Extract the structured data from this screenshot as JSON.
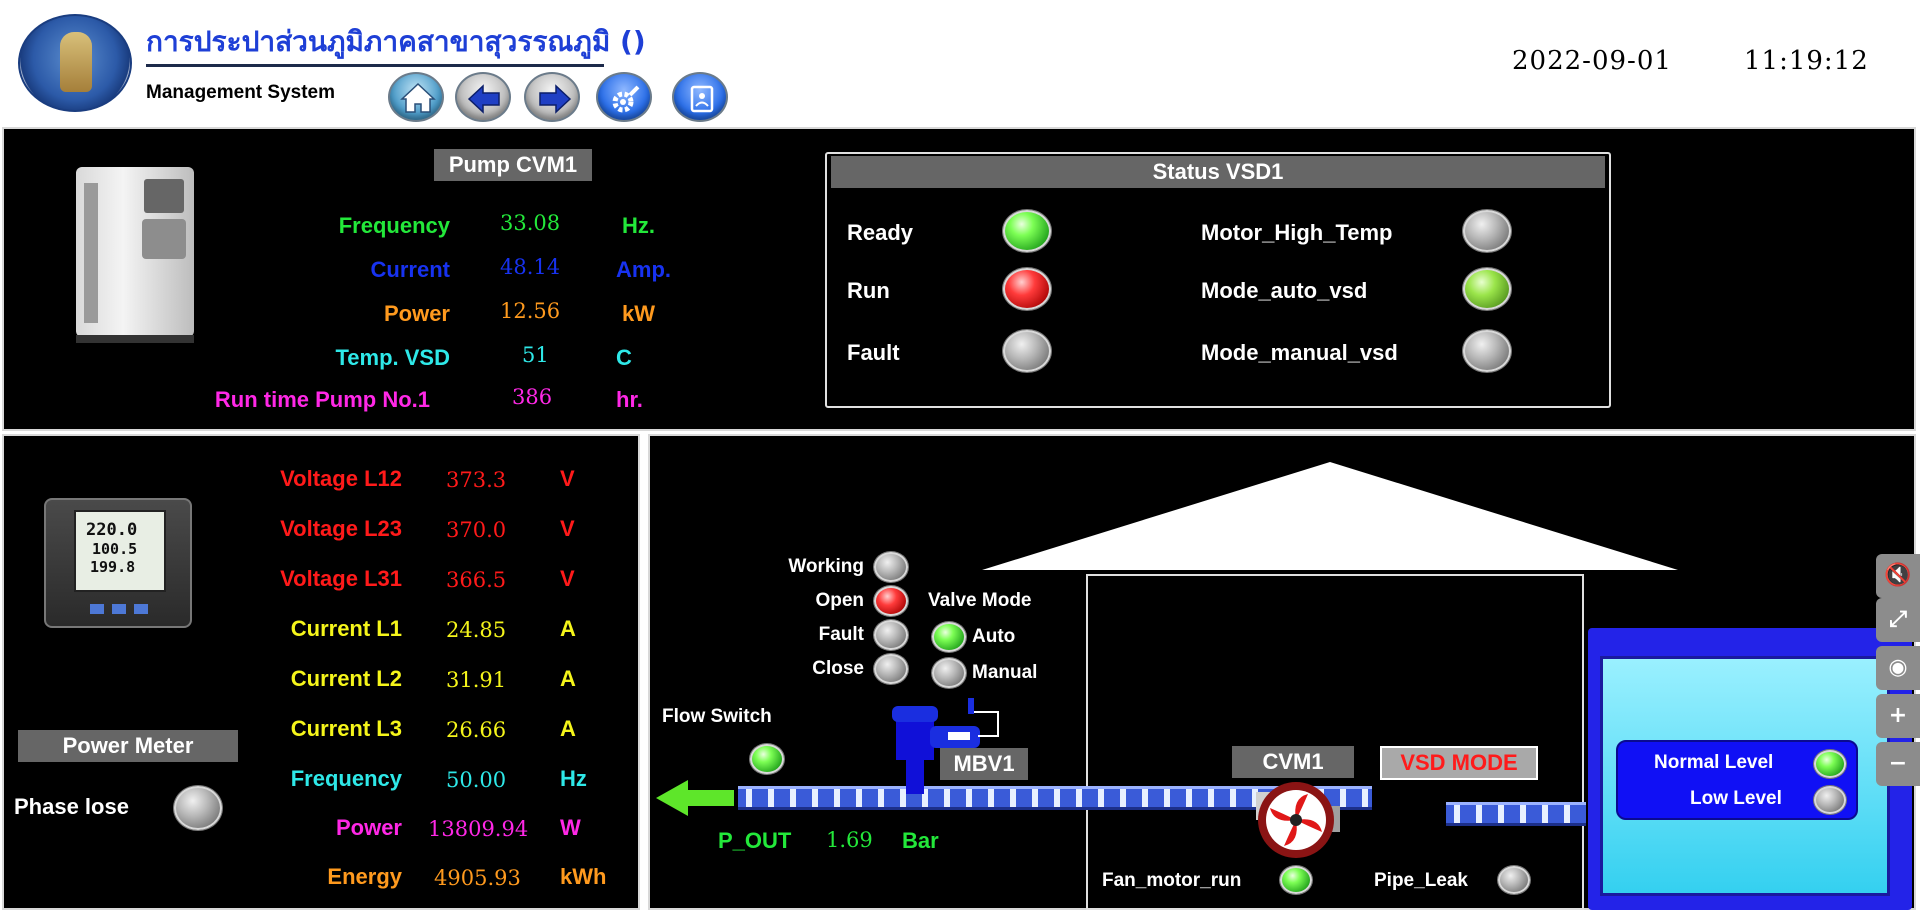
{
  "header": {
    "title": "การประปาส่วนภูมิภาคสาขาสุวรรณภูมิ ()",
    "subtitle": "Management System",
    "date": "2022-09-01",
    "time": "11:19:12",
    "nav": [
      "home-icon",
      "back-arrow-icon",
      "forward-arrow-icon",
      "settings-icon",
      "report-icon"
    ]
  },
  "pump": {
    "title": "Pump CVM1",
    "rows": [
      {
        "label": "Frequency",
        "value": "33.08",
        "unit": "Hz.",
        "color": "#23e83a"
      },
      {
        "label": "Current",
        "value": "48.14",
        "unit": "Amp.",
        "color": "#1732f0"
      },
      {
        "label": "Power",
        "value": "12.56",
        "unit": "kW",
        "color": "#ff9a1e"
      },
      {
        "label": "Temp. VSD",
        "value": "51",
        "unit": "C",
        "color": "#2ee8e8"
      },
      {
        "label": "Run time Pump No.1",
        "value": "386",
        "unit": "hr.",
        "color": "#ff28e6"
      }
    ]
  },
  "status": {
    "title": "Status VSD1",
    "left": [
      {
        "label": "Ready",
        "state": "green"
      },
      {
        "label": "Run",
        "state": "red"
      },
      {
        "label": "Fault",
        "state": "gray"
      }
    ],
    "right": [
      {
        "label": "Motor_High_Temp",
        "state": "gray"
      },
      {
        "label": "Mode_auto_vsd",
        "state": "lime"
      },
      {
        "label": "Mode_manual_vsd",
        "state": "gray"
      }
    ]
  },
  "meter": {
    "title": "Power Meter",
    "phase_lose": "Phase lose",
    "display": [
      "220.0",
      "100.5",
      "199.8"
    ],
    "rows": [
      {
        "label": "Voltage L12",
        "value": "373.3",
        "unit": "V",
        "color": "#ff1a1a"
      },
      {
        "label": "Voltage L23",
        "value": "370.0",
        "unit": "V",
        "color": "#ff1a1a"
      },
      {
        "label": "Voltage L31",
        "value": "366.5",
        "unit": "V",
        "color": "#ff1a1a"
      },
      {
        "label": "Current L1",
        "value": "24.85",
        "unit": "A",
        "color": "#f5f51a"
      },
      {
        "label": "Current L2",
        "value": "31.91",
        "unit": "A",
        "color": "#f5f51a"
      },
      {
        "label": "Current L3",
        "value": "26.66",
        "unit": "A",
        "color": "#f5f51a"
      },
      {
        "label": "Frequency",
        "value": "50.00",
        "unit": "Hz",
        "color": "#2ee8e8"
      },
      {
        "label": "Power",
        "value": "13809.94",
        "unit": "W",
        "color": "#ff28e6"
      },
      {
        "label": "Energy",
        "value": "4905.93",
        "unit": "kWh",
        "color": "#ff9a1e"
      }
    ]
  },
  "process": {
    "valve_status": [
      {
        "label": "Working",
        "state": "gray"
      },
      {
        "label": "Open",
        "state": "red"
      },
      {
        "label": "Fault",
        "state": "gray"
      },
      {
        "label": "Close",
        "state": "gray"
      }
    ],
    "valve_mode_title": "Valve Mode",
    "valve_modes": [
      {
        "label": "Auto",
        "state": "green"
      },
      {
        "label": "Manual",
        "state": "gray"
      }
    ],
    "flow_switch": "Flow Switch",
    "valve_tag": "MBV1",
    "pump_tag": "CVM1",
    "vsd_mode": "VSD MODE",
    "p_out_label": "P_OUT",
    "p_out_value": "1.69",
    "p_out_unit": "Bar",
    "fan_motor_run": "Fan_motor_run",
    "pipe_leak": "Pipe_Leak",
    "tank": {
      "normal_level": "Normal Level",
      "low_level": "Low Level"
    }
  },
  "side_toolbar": [
    "mute-icon",
    "fullscreen-icon",
    "eye-icon",
    "zoom-in-icon",
    "zoom-out-icon"
  ],
  "colors": {
    "accent_blue": "#1e3fd6",
    "panel_bg": "#000000",
    "tag_gray": "#666666",
    "vsd_red": "#ff1a1a"
  }
}
